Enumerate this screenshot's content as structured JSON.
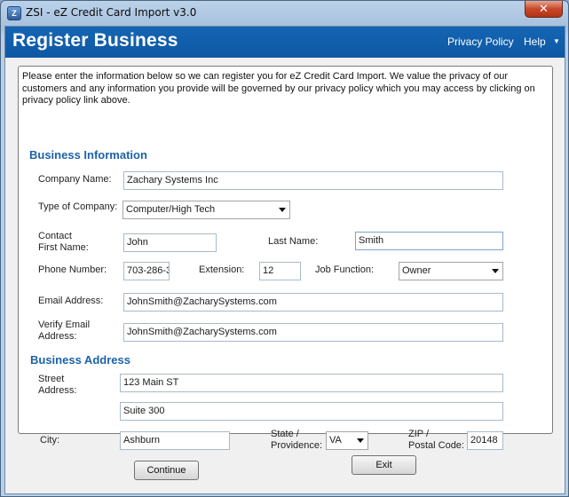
{
  "window": {
    "title": "ZSI - eZ Credit Card Import v3.0",
    "close_glyph": "✕"
  },
  "header": {
    "title": "Register Business",
    "privacy_link": "Privacy Policy",
    "help_link": "Help"
  },
  "intro": "Please enter the information below so we can register you for eZ Credit Card Import. We value the privacy of our customers and any information you provide will be governed by our privacy policy which you may access by clicking on privacy policy link above.",
  "business_info": {
    "title": "Business Information",
    "company_name_label": "Company Name:",
    "company_name_value": "Zachary Systems Inc",
    "company_type_label": "Type of Company:",
    "company_type_value": "Computer/High Tech",
    "contact_first_label_1": "Contact",
    "contact_first_label_2": "First Name:",
    "first_name_value": "John",
    "last_name_label": "Last Name:",
    "last_name_value": "Smith",
    "phone_label": "Phone Number:",
    "phone_value": "703-286-3",
    "extension_label": "Extension:",
    "extension_value": "12",
    "job_function_label": "Job Function:",
    "job_function_value": "Owner",
    "email_label": "Email Address:",
    "email_value": "JohnSmith@ZacharySystems.com",
    "verify_email_label_1": "Verify Email",
    "verify_email_label_2": "Address:",
    "verify_email_value": "JohnSmith@ZacharySystems.com"
  },
  "business_address": {
    "title": "Business Address",
    "street_label_1": "Street",
    "street_label_2": "Address:",
    "street_line1": "123 Main ST",
    "street_line2": "Suite 300",
    "city_label": "City:",
    "city_value": "Ashburn",
    "state_label_1": "State /",
    "state_label_2": "Providence:",
    "state_value": "VA",
    "zip_label_1": "ZIP /",
    "zip_label_2": "Postal Code:",
    "zip_value": "20148"
  },
  "buttons": {
    "continue": "Continue",
    "exit": "Exit"
  }
}
